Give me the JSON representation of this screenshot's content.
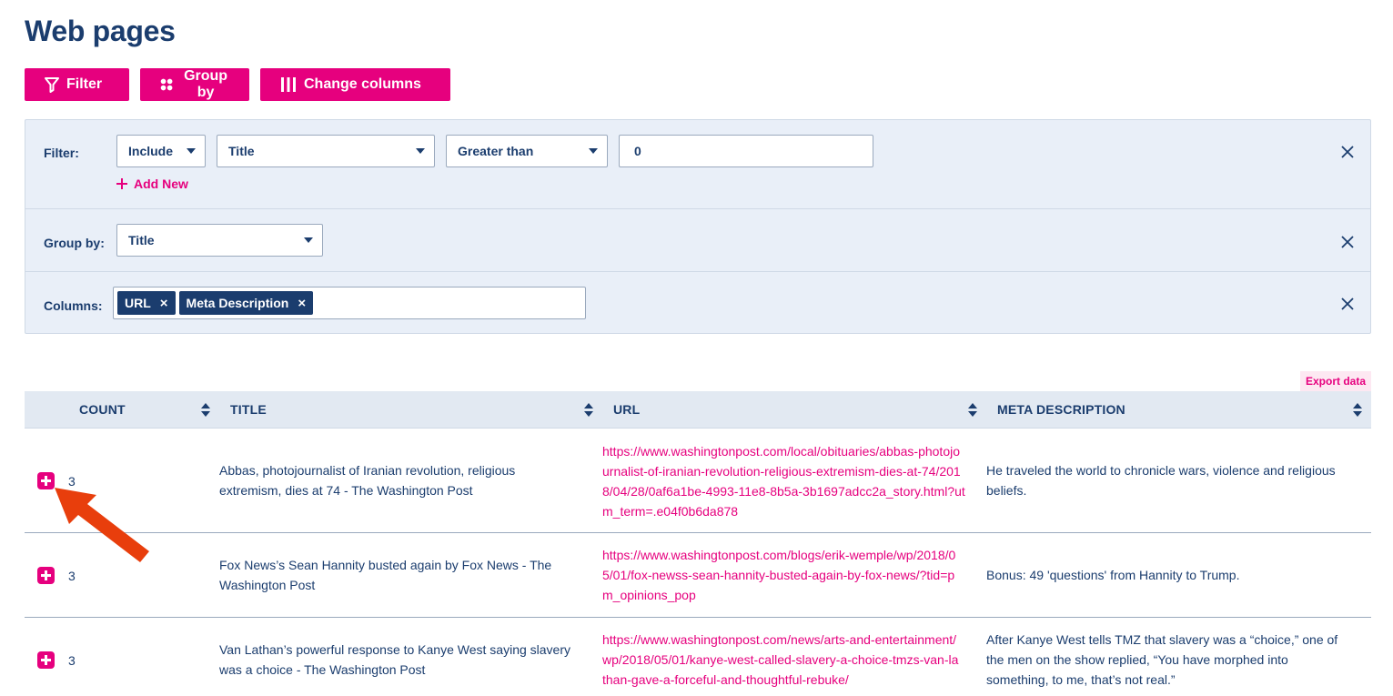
{
  "page": {
    "title": "Web pages"
  },
  "toolbar": {
    "filter_label": "Filter",
    "group_label": "Group by",
    "columns_label": "Change columns"
  },
  "filter": {
    "label": "Filter:",
    "mode": "Include",
    "field": "Title",
    "operator": "Greater than",
    "value": "0",
    "add_new_label": "Add New"
  },
  "group_by": {
    "label": "Group by:",
    "field": "Title"
  },
  "columns": {
    "label": "Columns:",
    "tags": [
      "URL",
      "Meta Description"
    ]
  },
  "export_label": "Export data",
  "table": {
    "headers": [
      "COUNT",
      "TITLE",
      "URL",
      "META DESCRIPTION"
    ],
    "rows": [
      {
        "count": "3",
        "title": "Abbas, photojournalist of Iranian revolution, religious extremism, dies at 74 - The Washington Post",
        "url": "https://www.washingtonpost.com/local/obituaries/abbas-photojournalist-of-iranian-revolution-religious-extremism-dies-at-74/2018/04/28/0af6a1be-4993-11e8-8b5a-3b1697adcc2a_story.html?utm_term=.e04f0b6da878",
        "meta": "He traveled the world to chronicle wars, violence and religious beliefs."
      },
      {
        "count": "3",
        "title": "Fox News’s Sean Hannity busted again by Fox News - The Washington Post",
        "url": "https://www.washingtonpost.com/blogs/erik-wemple/wp/2018/05/01/fox-newss-sean-hannity-busted-again-by-fox-news/?tid=pm_opinions_pop",
        "meta": "Bonus: 49 'questions' from Hannity to Trump."
      },
      {
        "count": "3",
        "title": "Van Lathan’s powerful response to Kanye West saying slavery was a choice - The Washington Post",
        "url": "https://www.washingtonpost.com/news/arts-and-entertainment/wp/2018/05/01/kanye-west-called-slavery-a-choice-tmzs-van-lathan-gave-a-forceful-and-thoughtful-rebuke/",
        "meta": "After Kanye West tells TMZ that slavery was a “choice,” one of the men on the show replied, “You have morphed into something, to me, that’s not real.”"
      }
    ]
  },
  "colors": {
    "accent": "#e6007e",
    "navy": "#1b3d6e",
    "panel": "#e9eff8",
    "arrow": "#e83e0c"
  }
}
